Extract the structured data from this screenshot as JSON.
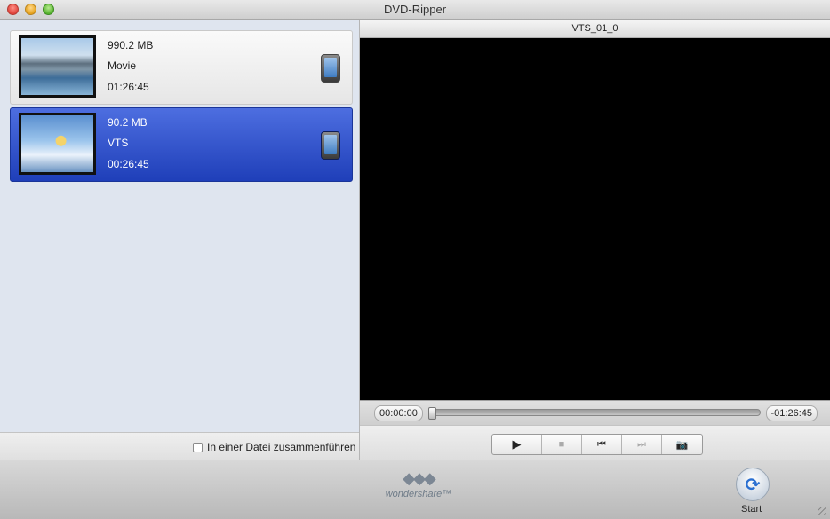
{
  "window": {
    "title": "DVD-Ripper"
  },
  "items": [
    {
      "size": "990.2 MB",
      "name": "Movie",
      "duration": "01:26:45",
      "selected": false,
      "thumbnail": "mountain-lake",
      "device_icon": "phone-icon"
    },
    {
      "size": "90.2 MB",
      "name": "VTS",
      "duration": "00:26:45",
      "selected": true,
      "thumbnail": "windsurfer",
      "device_icon": "phone-icon"
    }
  ],
  "merge": {
    "label": "In einer Datei zusammenführen",
    "checked": false
  },
  "preview": {
    "title": "VTS_01_0",
    "current_time": "00:00:00",
    "remaining_time": "-01:26:45",
    "progress": 0
  },
  "controls": [
    {
      "name": "play-icon",
      "glyph": "▶"
    },
    {
      "name": "stop-icon",
      "glyph": "■"
    },
    {
      "name": "previous-icon",
      "glyph": "⏮"
    },
    {
      "name": "next-icon",
      "glyph": "⏭"
    },
    {
      "name": "snapshot-icon",
      "glyph": "📷"
    }
  ],
  "footer": {
    "logo_text": "wondershare™",
    "start_label": "Start",
    "start_icon": "refresh-icon"
  },
  "colors": {
    "selection": "#2f4fcf",
    "video_bg": "#000000",
    "start_icon": "#2a6fd1"
  }
}
